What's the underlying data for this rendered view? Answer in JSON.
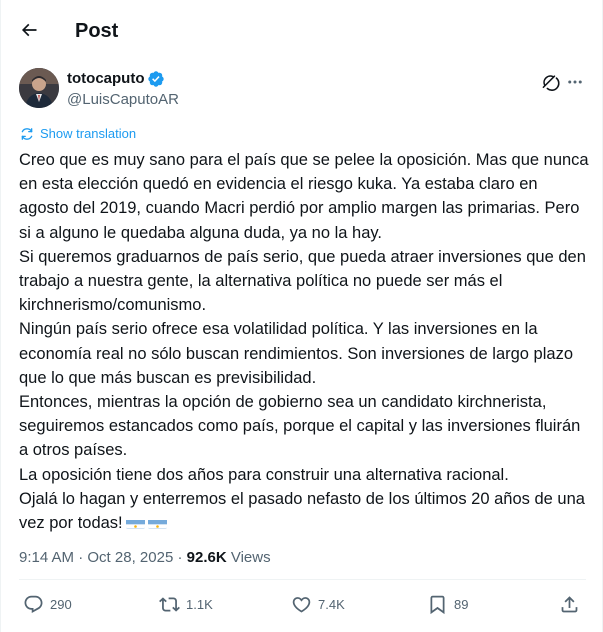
{
  "header": {
    "title": "Post"
  },
  "author": {
    "name": "totocaputo",
    "handle": "@LuisCaputoAR"
  },
  "translation": {
    "label": "Show translation"
  },
  "tweet": {
    "paragraphs": [
      "Creo que es muy sano para el país que se pelee la oposición. Mas que nunca en esta elección quedó en evidencia el riesgo kuka. Ya estaba claro en agosto del 2019, cuando Macri perdió por amplio margen las primarias. Pero si a alguno le quedaba alguna duda, ya no la hay.",
      "Si queremos graduarnos de país serio, que pueda atraer inversiones que den trabajo a nuestra gente, la alternativa política no puede ser más el kirchnerismo/comunismo.",
      "Ningún país serio ofrece esa volatilidad política. Y las inversiones en la economía real no sólo buscan rendimientos. Son inversiones de largo plazo que lo que más buscan es previsibilidad.",
      "Entonces, mientras la opción de gobierno sea un candidato kirchnerista, seguiremos estancados como país, porque el capital y las inversiones fluirán a otros países.",
      "La oposición tiene dos años para construir una alternativa racional.",
      "Ojalá lo hagan y enterremos el pasado nefasto de los últimos 20 años de una vez por todas!"
    ]
  },
  "meta": {
    "time": "9:14 AM",
    "separator": "·",
    "date": "Oct 28, 2025",
    "views_count": "92.6K",
    "views_label": "Views"
  },
  "actions": {
    "reply": "290",
    "retweet": "1.1K",
    "like": "7.4K",
    "bookmark": "89"
  },
  "colors": {
    "accent": "#1d9bf0",
    "text": "#0f1419",
    "secondary": "#536471",
    "border": "#eff3f4"
  },
  "icons": {
    "back": "arrow-left-icon",
    "verified": "verified-badge-icon",
    "grok": "grok-icon",
    "more": "more-horizontal-icon",
    "translate": "translate-icon",
    "reply": "reply-icon",
    "retweet": "retweet-icon",
    "like": "heart-icon",
    "bookmark": "bookmark-icon",
    "share": "share-icon",
    "flag": "argentina-flag-icon"
  }
}
